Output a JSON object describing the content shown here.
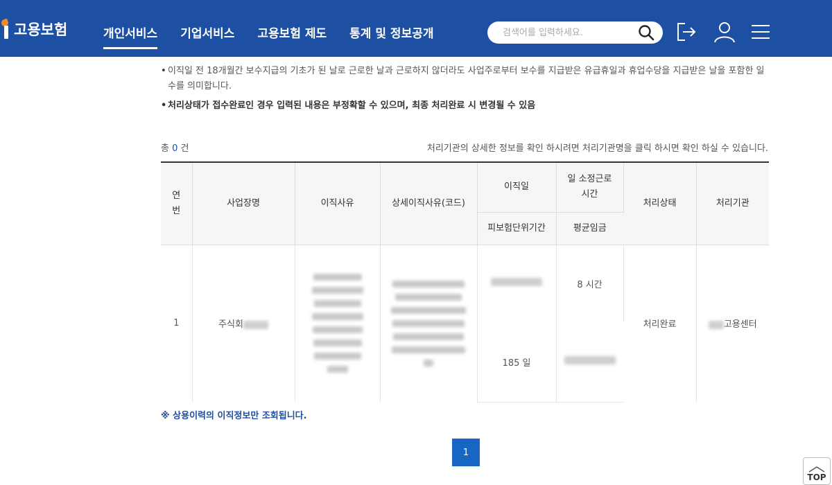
{
  "header": {
    "logo_text": "고용보험",
    "nav": [
      {
        "label": "개인서비스",
        "active": true
      },
      {
        "label": "기업서비스",
        "active": false
      },
      {
        "label": "고용보험 제도",
        "active": false
      },
      {
        "label": "통계 및 정보공개",
        "active": false
      }
    ],
    "search_placeholder": "검색어를 입력하세요.",
    "icons": [
      "logout-icon",
      "user-icon",
      "menu-icon"
    ]
  },
  "notes": {
    "item1": "이직일 전 18개월간 보수지급의 기초가 된 날로 근로한 날과 근로하지 않더라도 사업주로부터 보수를 지급받은 유급휴일과 휴업수당을 지급받은 날을 포함한 일수를 의미합니다.",
    "item2": "처리상태가 접수완료인 경우 입력된 내용은 부정확할 수 있으며, 최종 처리완료 시 변경될 수 있음"
  },
  "total": {
    "prefix": "총",
    "count": "0",
    "suffix": "건"
  },
  "guide": "처리기관의 상세한 정보를 확인 하시려면 처리기관명을 클릭 하시면 확인 하실 수 있습니다.",
  "table": {
    "headers": {
      "no": "연\n번",
      "company": "사업장명",
      "reason": "이직사유",
      "detail_reason": "상세이직사유(코드)",
      "leave_date": "이직일",
      "work_hours": "일 소정근로\n시간",
      "insured_period": "피보험단위기간",
      "avg_wage": "평균임금",
      "status": "처리상태",
      "agency": "처리기관"
    },
    "rows": [
      {
        "no": "1",
        "company_prefix": "주식회",
        "work_hours": "8 시간",
        "insured_period": "185 일",
        "status": "처리완료",
        "agency_suffix": "고용센터"
      }
    ]
  },
  "footnote": "※ 상용이력의 이직정보만 조회됩니다.",
  "pagination": {
    "current": "1"
  },
  "top_button": "TOP",
  "colors": {
    "header_bg": "#1d4fa3",
    "accent": "#1766c4"
  }
}
